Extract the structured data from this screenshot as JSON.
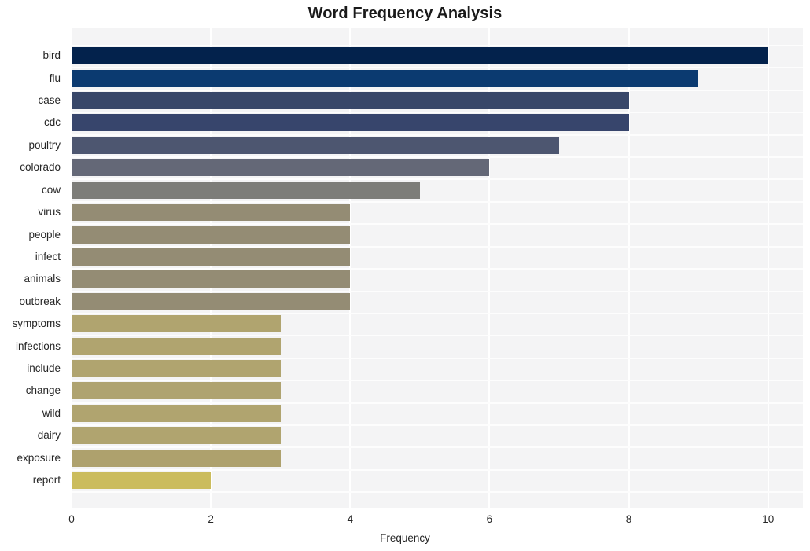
{
  "chart_data": {
    "type": "bar",
    "orientation": "horizontal",
    "title": "Word Frequency Analysis",
    "xlabel": "Frequency",
    "ylabel": "",
    "xlim": [
      0,
      10.5
    ],
    "xticks": [
      0,
      2,
      4,
      6,
      8,
      10
    ],
    "xtick_labels": [
      "0",
      "2",
      "4",
      "6",
      "8",
      "10"
    ],
    "grid": true,
    "legend": null,
    "categories": [
      "bird",
      "flu",
      "case",
      "cdc",
      "poultry",
      "colorado",
      "cow",
      "virus",
      "people",
      "infect",
      "animals",
      "outbreak",
      "symptoms",
      "infections",
      "include",
      "change",
      "wild",
      "dairy",
      "exposure",
      "report"
    ],
    "values": [
      10,
      9,
      8,
      8,
      7,
      6,
      5,
      4,
      4,
      4,
      4,
      4,
      3,
      3,
      3,
      3,
      3,
      3,
      3,
      2
    ],
    "bar_colors": [
      "#03224c",
      "#0b3a70",
      "#384769",
      "#37456c",
      "#4d5670",
      "#646877",
      "#7d7d79",
      "#948c74",
      "#948c74",
      "#948c74",
      "#948c74",
      "#948c74",
      "#b0a46f",
      "#b0a46f",
      "#b0a46f",
      "#afa370",
      "#b0a46f",
      "#b0a46f",
      "#aea16d",
      "#cbbc5d"
    ],
    "plot_background": "#f4f4f5",
    "figure_background": "#ffffff",
    "gridline_color": "#ffffff",
    "text_color": "#262626",
    "title_color": "#1a1a1a"
  }
}
